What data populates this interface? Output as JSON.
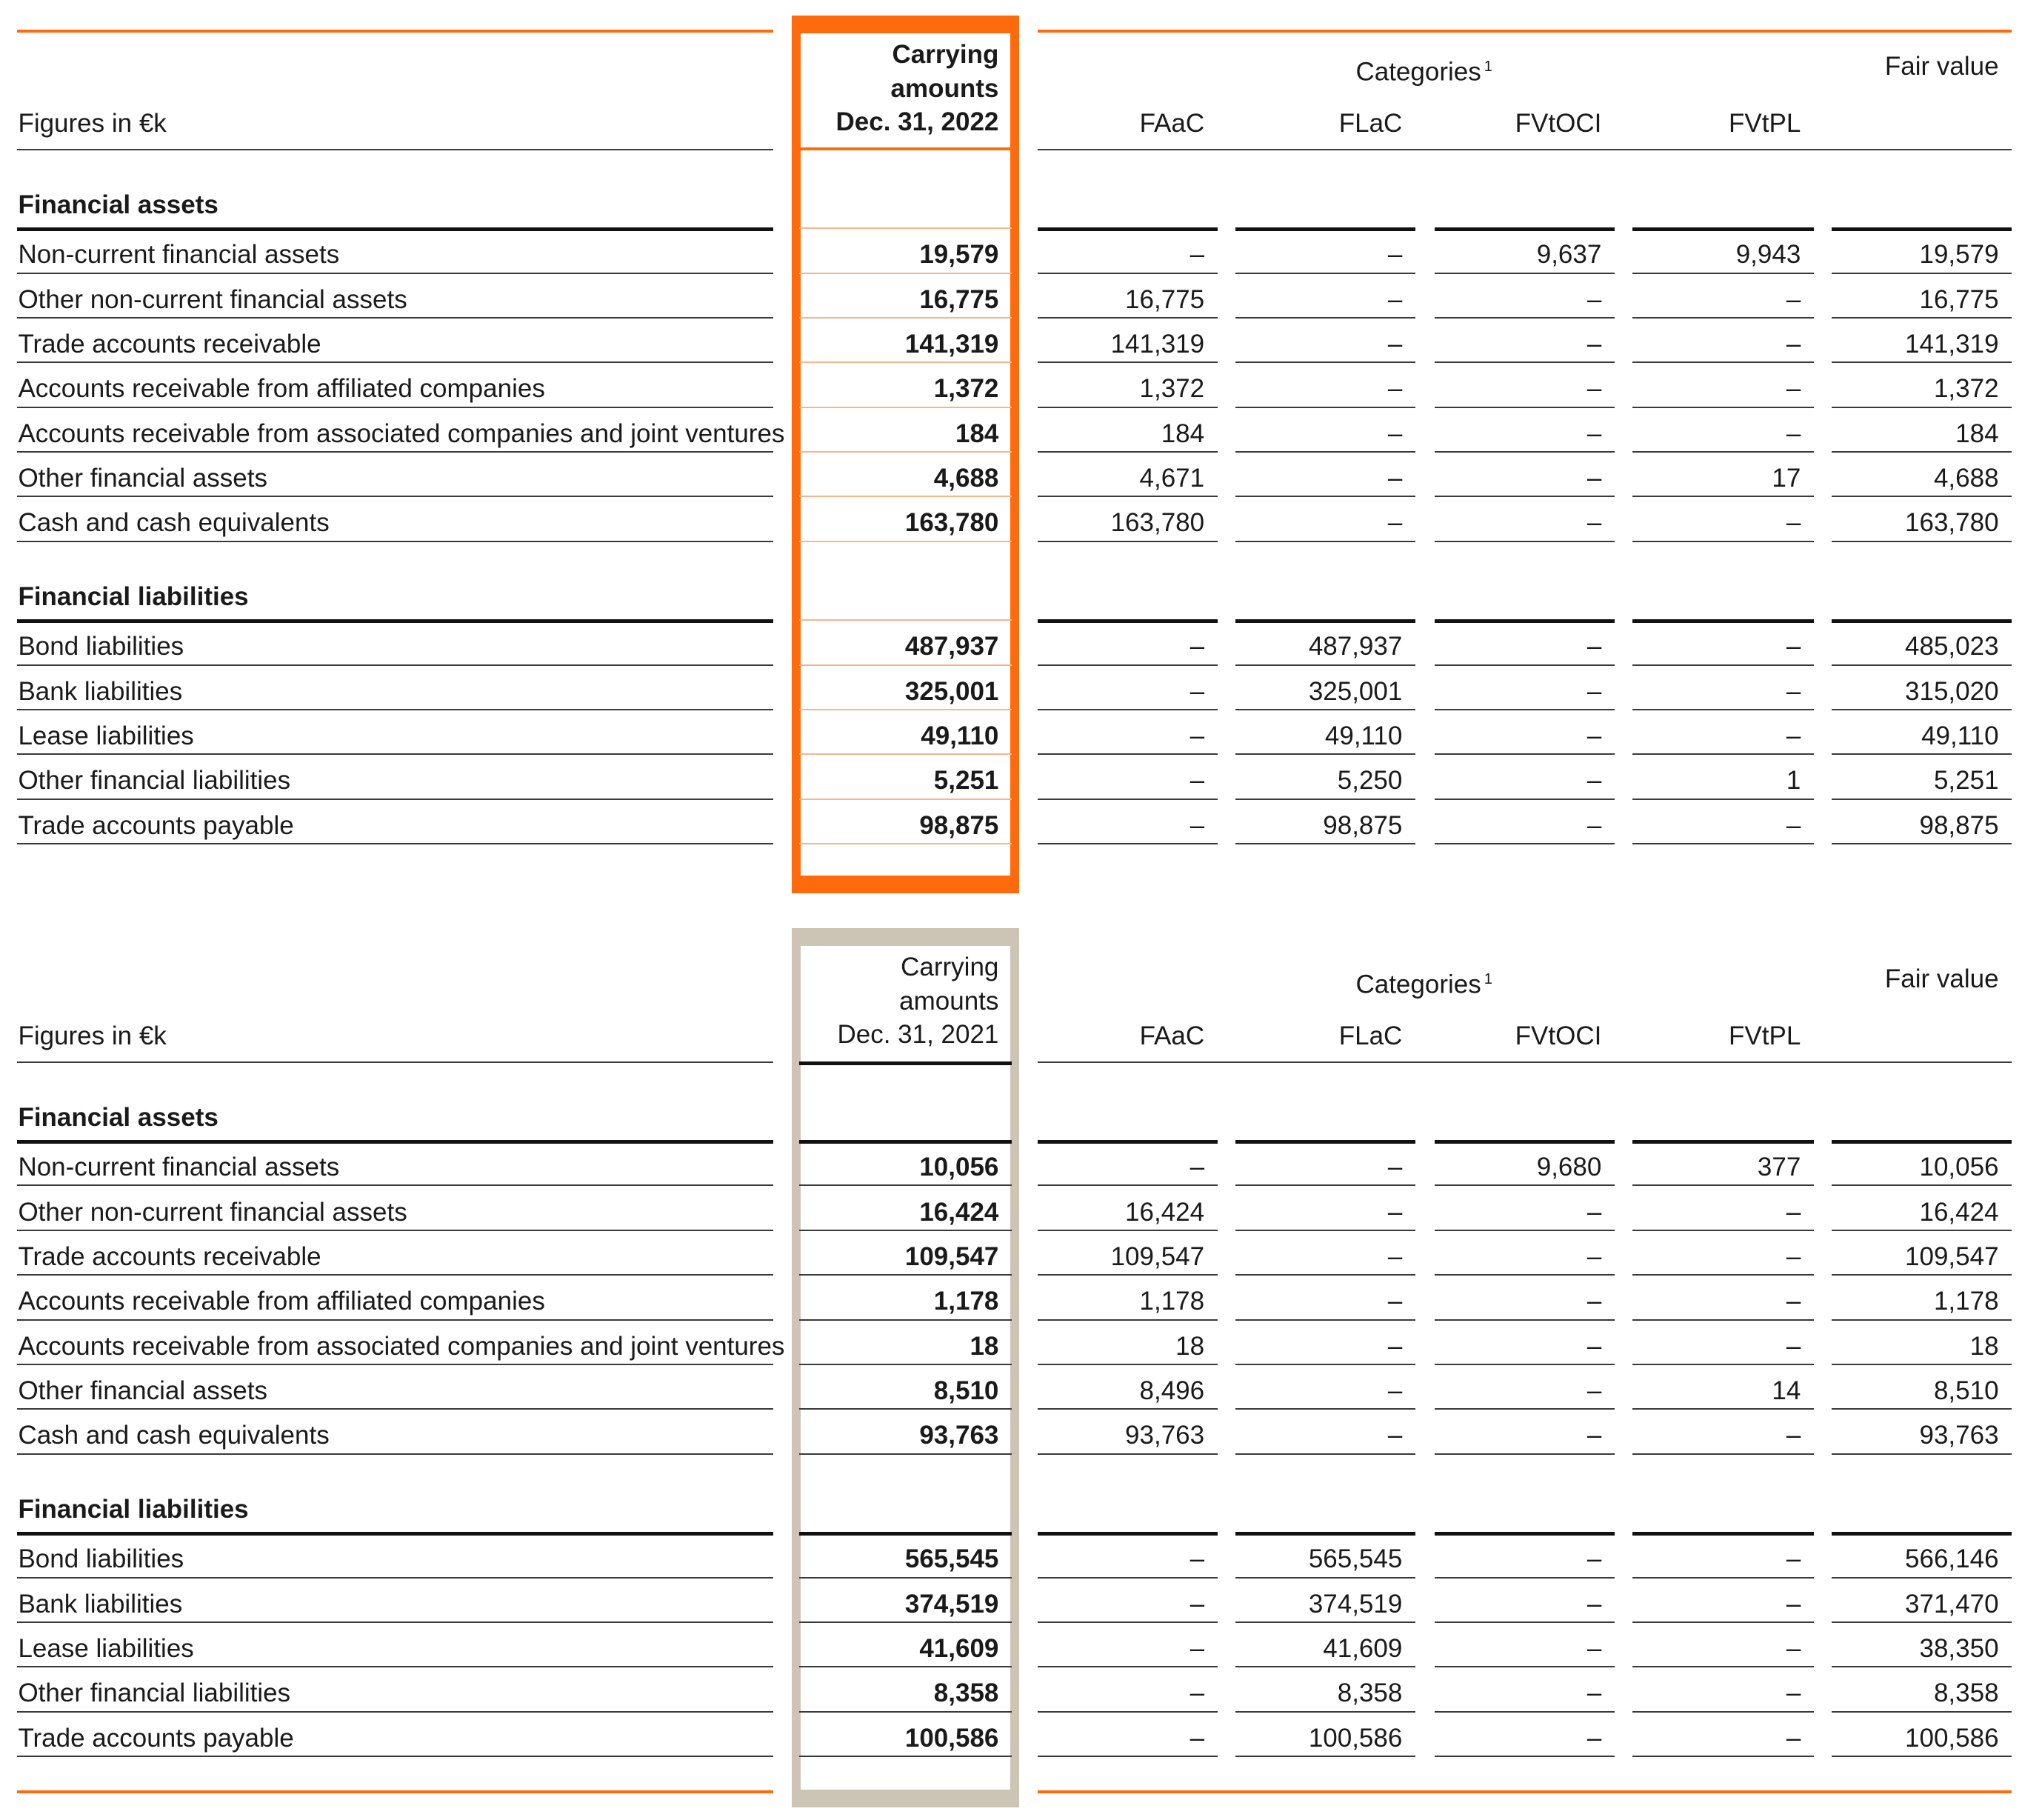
{
  "unit_label": "Figures in €k",
  "header": {
    "carrying_line1": "Carrying",
    "carrying_line2": "amounts",
    "categories": "Categories",
    "categories_footnote": "1",
    "fair_value": "Fair value",
    "category_columns": [
      "FAaC",
      "FLaC",
      "FVtOCI",
      "FVtPL"
    ]
  },
  "colors": {
    "accent_2022": "#ff6a0d",
    "accent_2021": "#ccc5b6"
  },
  "tables": [
    {
      "date_label": "Dec. 31, 2022",
      "sections": [
        {
          "title": "Financial assets",
          "rows": [
            {
              "label": "Non-current financial assets",
              "carrying": "19,579",
              "faac": "–",
              "flac": "–",
              "fvtoci": "9,637",
              "fvtpl": "9,943",
              "fair_value": "19,579"
            },
            {
              "label": "Other non-current financial assets",
              "carrying": "16,775",
              "faac": "16,775",
              "flac": "–",
              "fvtoci": "–",
              "fvtpl": "–",
              "fair_value": "16,775"
            },
            {
              "label": "Trade accounts receivable",
              "carrying": "141,319",
              "faac": "141,319",
              "flac": "–",
              "fvtoci": "–",
              "fvtpl": "–",
              "fair_value": "141,319"
            },
            {
              "label": "Accounts receivable from affiliated companies",
              "carrying": "1,372",
              "faac": "1,372",
              "flac": "–",
              "fvtoci": "–",
              "fvtpl": "–",
              "fair_value": "1,372"
            },
            {
              "label": "Accounts receivable from associated companies and joint ventures",
              "carrying": "184",
              "faac": "184",
              "flac": "–",
              "fvtoci": "–",
              "fvtpl": "–",
              "fair_value": "184"
            },
            {
              "label": "Other financial assets",
              "carrying": "4,688",
              "faac": "4,671",
              "flac": "–",
              "fvtoci": "–",
              "fvtpl": "17",
              "fair_value": "4,688"
            },
            {
              "label": "Cash and cash equivalents",
              "carrying": "163,780",
              "faac": "163,780",
              "flac": "–",
              "fvtoci": "–",
              "fvtpl": "–",
              "fair_value": "163,780"
            }
          ]
        },
        {
          "title": "Financial liabilities",
          "rows": [
            {
              "label": "Bond liabilities",
              "carrying": "487,937",
              "faac": "–",
              "flac": "487,937",
              "fvtoci": "–",
              "fvtpl": "–",
              "fair_value": "485,023"
            },
            {
              "label": "Bank liabilities",
              "carrying": "325,001",
              "faac": "–",
              "flac": "325,001",
              "fvtoci": "–",
              "fvtpl": "–",
              "fair_value": "315,020"
            },
            {
              "label": "Lease liabilities",
              "carrying": "49,110",
              "faac": "–",
              "flac": "49,110",
              "fvtoci": "–",
              "fvtpl": "–",
              "fair_value": "49,110"
            },
            {
              "label": "Other financial liabilities",
              "carrying": "5,251",
              "faac": "–",
              "flac": "5,250",
              "fvtoci": "–",
              "fvtpl": "1",
              "fair_value": "5,251"
            },
            {
              "label": "Trade accounts payable",
              "carrying": "98,875",
              "faac": "–",
              "flac": "98,875",
              "fvtoci": "–",
              "fvtpl": "–",
              "fair_value": "98,875"
            }
          ]
        }
      ]
    },
    {
      "date_label": "Dec. 31, 2021",
      "sections": [
        {
          "title": "Financial assets",
          "rows": [
            {
              "label": "Non-current financial assets",
              "carrying": "10,056",
              "faac": "–",
              "flac": "–",
              "fvtoci": "9,680",
              "fvtpl": "377",
              "fair_value": "10,056"
            },
            {
              "label": "Other non-current financial assets",
              "carrying": "16,424",
              "faac": "16,424",
              "flac": "–",
              "fvtoci": "–",
              "fvtpl": "–",
              "fair_value": "16,424"
            },
            {
              "label": "Trade accounts receivable",
              "carrying": "109,547",
              "faac": "109,547",
              "flac": "–",
              "fvtoci": "–",
              "fvtpl": "–",
              "fair_value": "109,547"
            },
            {
              "label": "Accounts receivable from affiliated companies",
              "carrying": "1,178",
              "faac": "1,178",
              "flac": "–",
              "fvtoci": "–",
              "fvtpl": "–",
              "fair_value": "1,178"
            },
            {
              "label": "Accounts receivable from associated companies and joint ventures",
              "carrying": "18",
              "faac": "18",
              "flac": "–",
              "fvtoci": "–",
              "fvtpl": "–",
              "fair_value": "18"
            },
            {
              "label": "Other financial assets",
              "carrying": "8,510",
              "faac": "8,496",
              "flac": "–",
              "fvtoci": "–",
              "fvtpl": "14",
              "fair_value": "8,510"
            },
            {
              "label": "Cash and cash equivalents",
              "carrying": "93,763",
              "faac": "93,763",
              "flac": "–",
              "fvtoci": "–",
              "fvtpl": "–",
              "fair_value": "93,763"
            }
          ]
        },
        {
          "title": "Financial liabilities",
          "rows": [
            {
              "label": "Bond liabilities",
              "carrying": "565,545",
              "faac": "–",
              "flac": "565,545",
              "fvtoci": "–",
              "fvtpl": "–",
              "fair_value": "566,146"
            },
            {
              "label": "Bank liabilities",
              "carrying": "374,519",
              "faac": "–",
              "flac": "374,519",
              "fvtoci": "–",
              "fvtpl": "–",
              "fair_value": "371,470"
            },
            {
              "label": "Lease liabilities",
              "carrying": "41,609",
              "faac": "–",
              "flac": "41,609",
              "fvtoci": "–",
              "fvtpl": "–",
              "fair_value": "38,350"
            },
            {
              "label": "Other financial liabilities",
              "carrying": "8,358",
              "faac": "–",
              "flac": "8,358",
              "fvtoci": "–",
              "fvtpl": "–",
              "fair_value": "8,358"
            },
            {
              "label": "Trade accounts payable",
              "carrying": "100,586",
              "faac": "–",
              "flac": "100,586",
              "fvtoci": "–",
              "fvtpl": "–",
              "fair_value": "100,586"
            }
          ]
        }
      ]
    }
  ]
}
